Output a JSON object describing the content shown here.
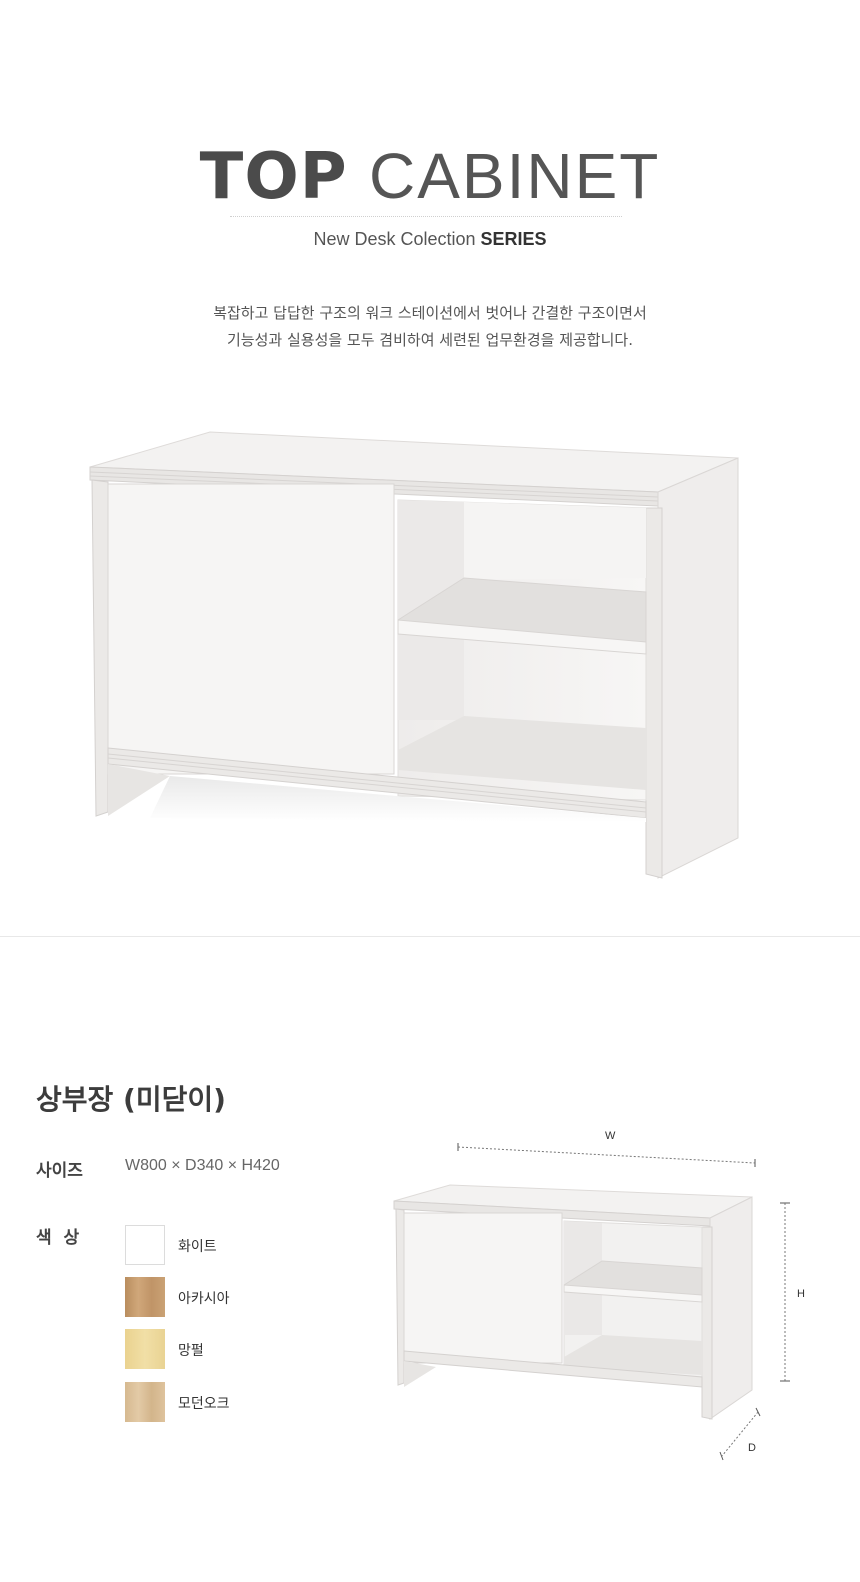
{
  "header": {
    "title_bold": "TOP",
    "title_light": "CABINET",
    "subtitle_main": "New Desk Colection ",
    "subtitle_bold": "SERIES"
  },
  "description": {
    "line1": "복잡하고 답답한 구조의 워크 스테이션에서 벗어나 간결한 구조이면서",
    "line2": "기능성과 실용성을 모두 겸비하여 세련된 업무환경을 제공합니다."
  },
  "product": {
    "name": "상부장 (미닫이)",
    "size_label": "사이즈",
    "size_value": "W800 × D340 × H420",
    "color_label": "색  상",
    "colors": [
      {
        "name": "화이트",
        "hex": "#ffffff"
      },
      {
        "name": "아카시아",
        "hex": "#c49b6c"
      },
      {
        "name": "망펄",
        "hex": "#eed99a"
      },
      {
        "name": "모던오크",
        "hex": "#dcc19c"
      }
    ]
  },
  "dimensions": {
    "w": "W",
    "h": "H",
    "d": "D"
  },
  "colors": {
    "cabinet_body": "#efedec",
    "cabinet_edge": "#d9d6d4",
    "interior": "#e6e4e3",
    "door": "#f6f5f4"
  }
}
